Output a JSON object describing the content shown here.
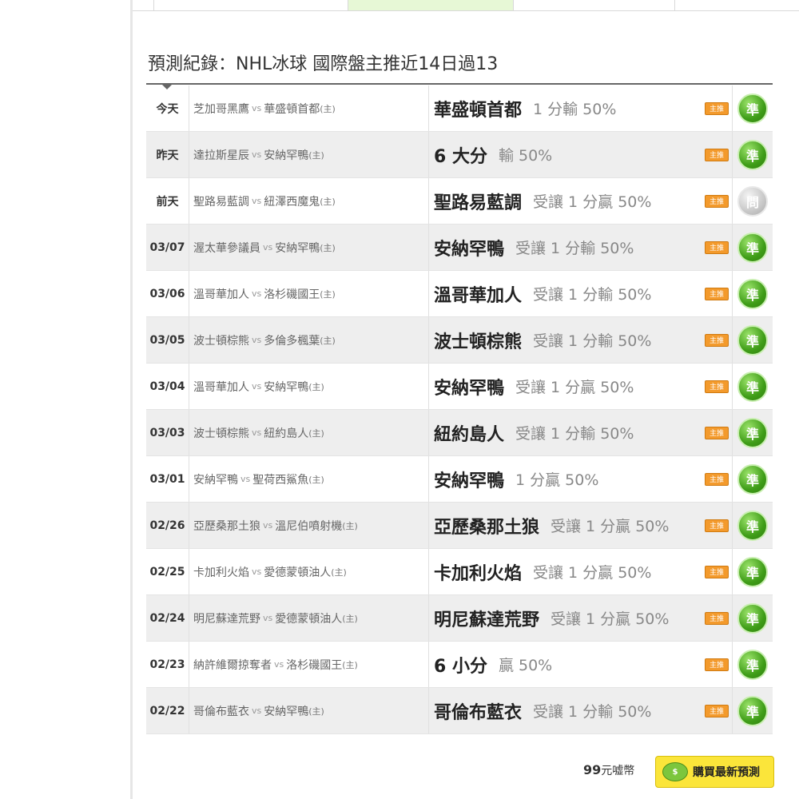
{
  "title": "預測紀錄：NHL冰球 國際盤主推近14日過13",
  "vs_text": "vs",
  "host_mark": "(主)",
  "badge_text": "主推",
  "rows": [
    {
      "date": "今天",
      "away": "芝加哥黑鷹",
      "home": "華盛頓首都",
      "pick": "華盛頓首都",
      "detail": "1 分輸 50%",
      "result": "準",
      "result_type": "ok"
    },
    {
      "date": "昨天",
      "away": "達拉斯星辰",
      "home": "安納罕鴨",
      "pick": "6 大分",
      "detail": "輸 50%",
      "result": "準",
      "result_type": "ok"
    },
    {
      "date": "前天",
      "away": "聖路易藍調",
      "home": "紐澤西魔鬼",
      "pick": "聖路易藍調",
      "detail": "受讓 1 分贏 50%",
      "result": "問",
      "result_type": "tie"
    },
    {
      "date": "03/07",
      "away": "渥太華參議員",
      "home": "安納罕鴨",
      "pick": "安納罕鴨",
      "detail": "受讓 1 分輸 50%",
      "result": "準",
      "result_type": "ok"
    },
    {
      "date": "03/06",
      "away": "溫哥華加人",
      "home": "洛杉磯國王",
      "pick": "溫哥華加人",
      "detail": "受讓 1 分輸 50%",
      "result": "準",
      "result_type": "ok"
    },
    {
      "date": "03/05",
      "away": "波士頓棕熊",
      "home": "多倫多楓葉",
      "pick": "波士頓棕熊",
      "detail": "受讓 1 分輸 50%",
      "result": "準",
      "result_type": "ok"
    },
    {
      "date": "03/04",
      "away": "溫哥華加人",
      "home": "安納罕鴨",
      "pick": "安納罕鴨",
      "detail": "受讓 1 分贏 50%",
      "result": "準",
      "result_type": "ok"
    },
    {
      "date": "03/03",
      "away": "波士頓棕熊",
      "home": "紐約島人",
      "pick": "紐約島人",
      "detail": "受讓 1 分輸 50%",
      "result": "準",
      "result_type": "ok"
    },
    {
      "date": "03/01",
      "away": "安納罕鴨",
      "home": "聖荷西鯊魚",
      "pick": "安納罕鴨",
      "detail": "1 分贏 50%",
      "result": "準",
      "result_type": "ok"
    },
    {
      "date": "02/26",
      "away": "亞歷桑那土狼",
      "home": "溫尼伯噴射機",
      "pick": "亞歷桑那土狼",
      "detail": "受讓 1 分贏 50%",
      "result": "準",
      "result_type": "ok"
    },
    {
      "date": "02/25",
      "away": "卡加利火焰",
      "home": "愛德蒙頓油人",
      "pick": "卡加利火焰",
      "detail": "受讓 1 分贏 50%",
      "result": "準",
      "result_type": "ok"
    },
    {
      "date": "02/24",
      "away": "明尼蘇達荒野",
      "home": "愛德蒙頓油人",
      "pick": "明尼蘇達荒野",
      "detail": "受讓 1 分贏 50%",
      "result": "準",
      "result_type": "ok"
    },
    {
      "date": "02/23",
      "away": "納許維爾掠奪者",
      "home": "洛杉磯國王",
      "pick": "6 小分",
      "detail": "贏 50%",
      "result": "準",
      "result_type": "ok"
    },
    {
      "date": "02/22",
      "away": "哥倫布藍衣",
      "home": "安納罕鴨",
      "pick": "哥倫布藍衣",
      "detail": "受讓 1 分輸 50%",
      "result": "準",
      "result_type": "ok"
    }
  ],
  "footer": {
    "price": "99",
    "price_unit": "元嘘幣",
    "buy_label": "購買最新預測",
    "coin_icon": "coin-icon"
  },
  "colors": {
    "badge": "#f39a2c",
    "result_ok": "#3f9d18",
    "result_tie": "#c8c8c8",
    "buy_button": "#fbe53a",
    "active_tab": "#e7f8d6"
  }
}
